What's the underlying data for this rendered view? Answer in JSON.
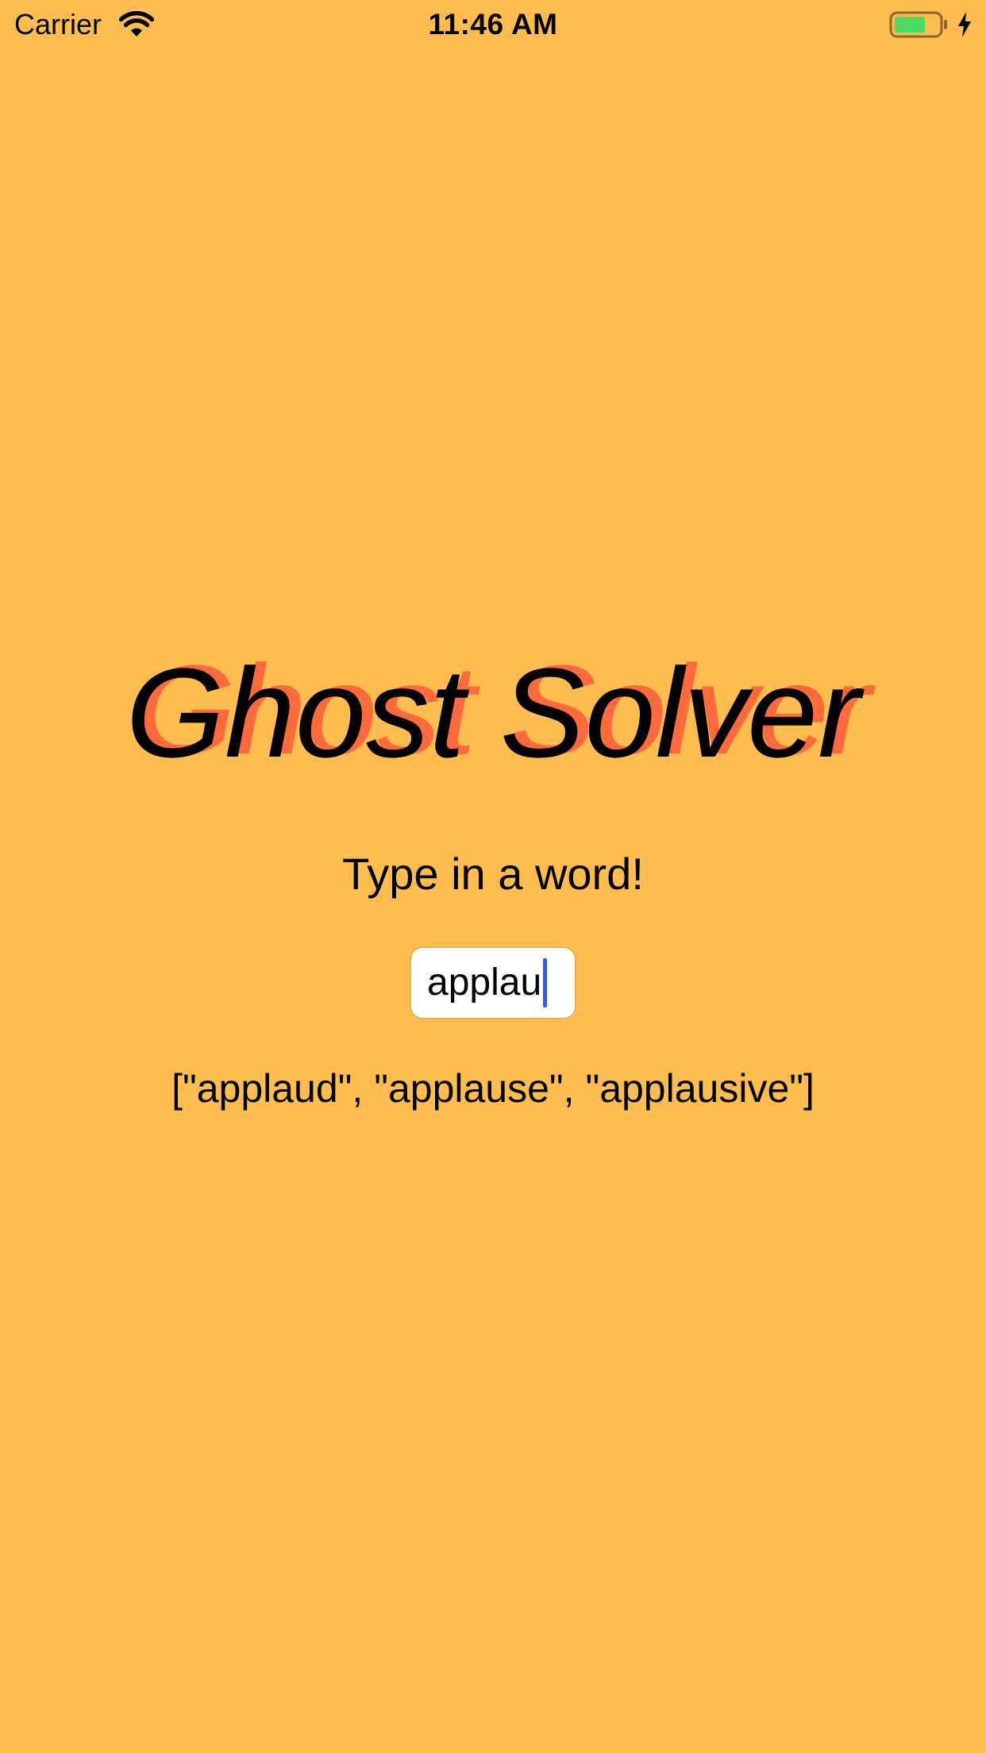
{
  "status_bar": {
    "carrier": "Carrier",
    "time": "11:46 AM",
    "icons": [
      "wifi-icon",
      "battery-icon",
      "charging-bolt-icon"
    ],
    "battery_color": "#4CD964"
  },
  "app": {
    "title": "Ghost Solver",
    "subtitle": "Type in a word!",
    "input": {
      "value": "applau"
    },
    "results": "[\"applaud\", \"applause\", \"applausive\"]"
  },
  "colors": {
    "background": "#FFBD4F",
    "title_shadow": "#FF6A3D",
    "caret": "#3B5BDB"
  }
}
